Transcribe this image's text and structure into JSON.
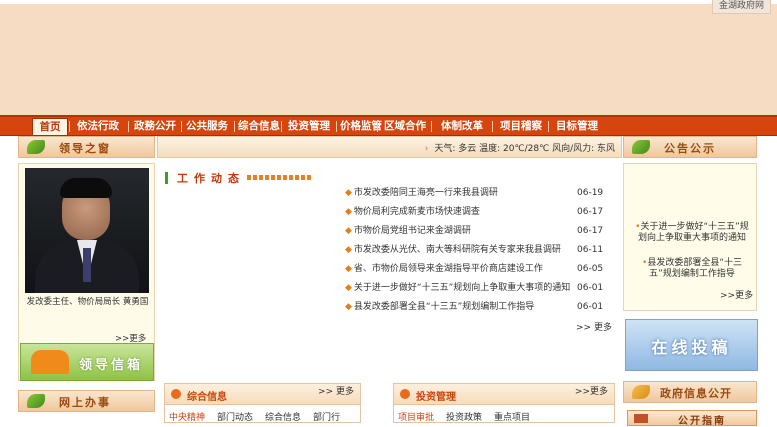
{
  "banner": {
    "top_link": "金湖政府网"
  },
  "nav": {
    "items": [
      {
        "label": "首页",
        "active": true
      },
      {
        "label": "依法行政"
      },
      {
        "label": "政務公开"
      },
      {
        "label": "公共服务"
      },
      {
        "label": "综合信息"
      },
      {
        "label": "投资管理"
      },
      {
        "label": "价格监管"
      },
      {
        "label": "区域合作"
      },
      {
        "label": "体制改革"
      },
      {
        "label": "项目稽察"
      },
      {
        "label": "目标管理"
      }
    ]
  },
  "left": {
    "leaders_title": "领导之窗",
    "leader_caption": "发改委主任、物价局局长 黄勇国",
    "leader_more": ">>更多",
    "mailbox_title": "领导信箱",
    "online_title": "网上办事"
  },
  "infobar": {
    "weather": "天气: 多云  温度: 20℃/28℃  风向/风力: 东风"
  },
  "news": {
    "title": "工作动态",
    "items": [
      {
        "title": "市发改委陪同王海亮一行来我县调研",
        "date": "06-19"
      },
      {
        "title": "物价局利完成新麦市场快速调查",
        "date": "06-17"
      },
      {
        "title": "市物价局党组书记来金湖调研",
        "date": "06-17"
      },
      {
        "title": "市发改委从光伏、南大等科研院有关专家来我县调研",
        "date": "06-11"
      },
      {
        "title": "省、市物价局领导来金湖指导平价商店建设工作",
        "date": "06-05"
      },
      {
        "title": "关于进一步做好“十三五”规划向上争取重大事项的通知",
        "date": "06-01"
      },
      {
        "title": "县发改委部署全县“十三五”规划编制工作指导",
        "date": "06-01"
      }
    ],
    "more": ">> 更多"
  },
  "boxes": [
    {
      "title": "综合信息",
      "more": ">> 更多",
      "tabs": [
        "中央精神",
        "部门动态",
        "综合信息",
        "部门行"
      ]
    },
    {
      "title": "投资管理",
      "more": ">>更多",
      "tabs": [
        "项目审批",
        "投资政策",
        "重点项目"
      ]
    }
  ],
  "right": {
    "notice_title": "公告公示",
    "notices": [
      "关于进一步做好“十三五”规划向上争取重大事项的通知",
      "县发改委部署全县“十三五”规划编制工作指导"
    ],
    "notice_more": ">>更多",
    "online_submit": "在线投稿",
    "gov_info_title": "政府信息公开",
    "guide_label": "公开指南"
  }
}
